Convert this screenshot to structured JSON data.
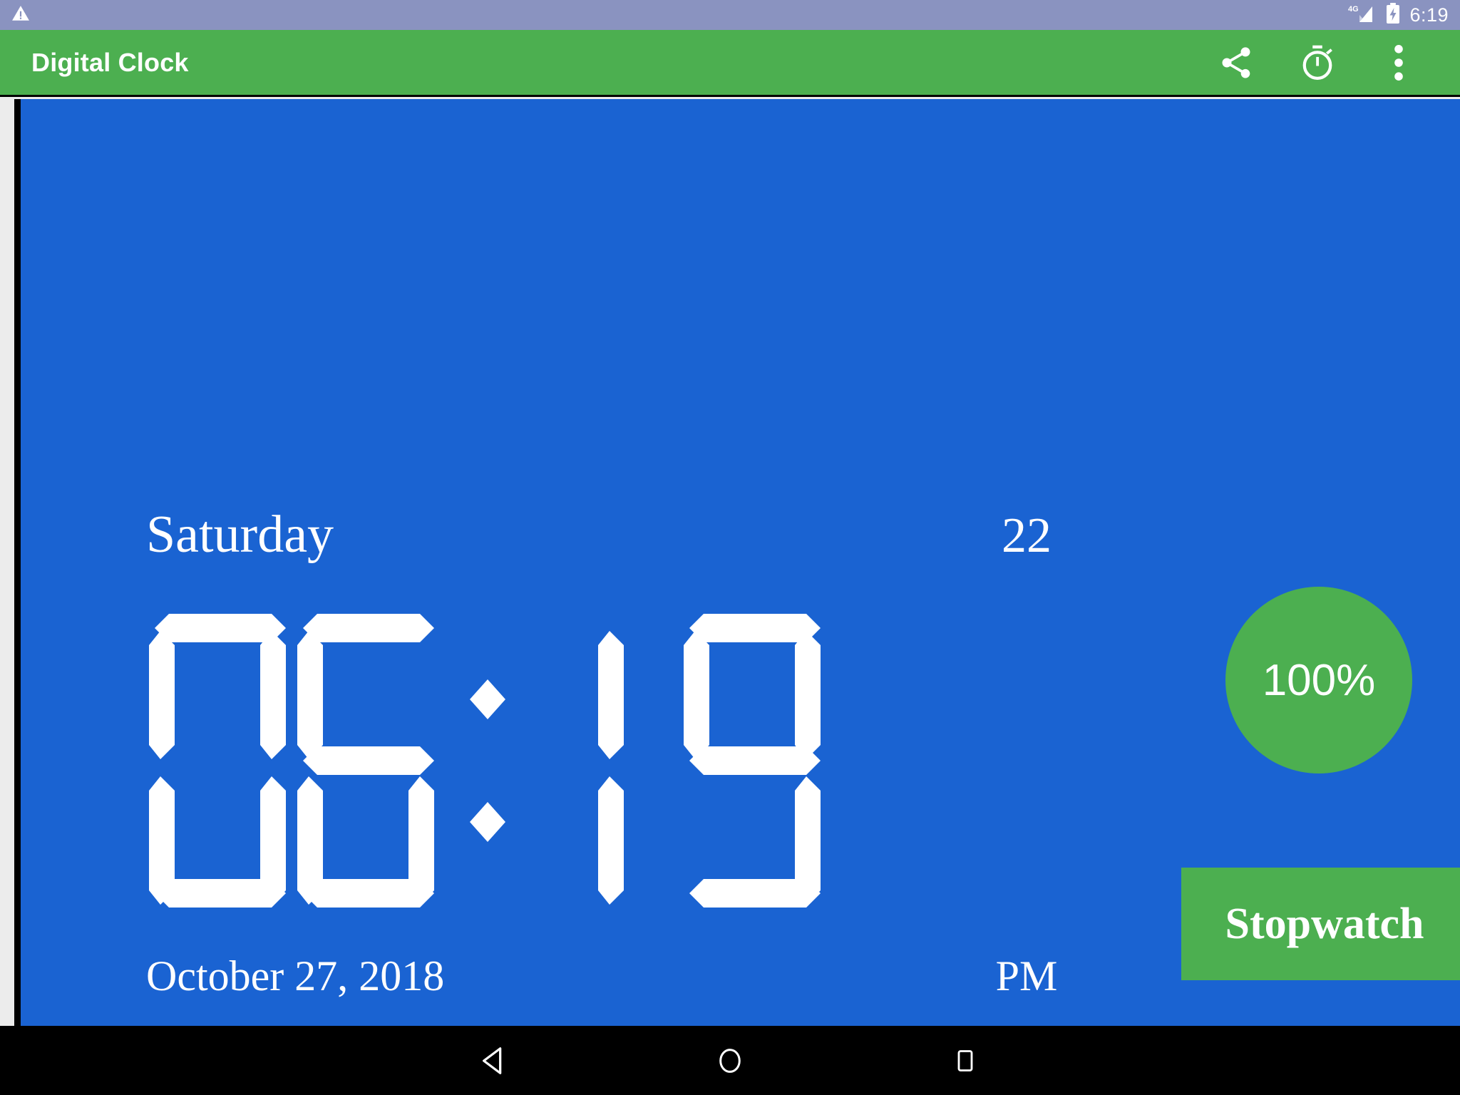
{
  "status_bar": {
    "warning_icon": "warning-triangle-icon",
    "network_label": "4G",
    "signal_icon": "signal-bars-icon",
    "battery_icon": "battery-charging-icon",
    "time": "6:19",
    "background_color": "#8a93c0"
  },
  "app_bar": {
    "title": "Digital Clock",
    "background_color": "#4caf50",
    "actions": [
      {
        "name": "share-icon",
        "label": "Share"
      },
      {
        "name": "stopwatch-icon",
        "label": "Stopwatch"
      },
      {
        "name": "overflow-menu-icon",
        "label": "More options"
      }
    ]
  },
  "clock": {
    "background_color": "#1a63d2",
    "day_of_week": "Saturday",
    "seconds": "22",
    "hours": "06",
    "minutes": "19",
    "hour_digits": [
      "0",
      "6"
    ],
    "minute_digits": [
      "1",
      "9"
    ],
    "separator": ":",
    "date": "October 27, 2018",
    "meridiem": "PM"
  },
  "battery": {
    "percent_label": "100%",
    "percent_value": 100,
    "color": "#4caf50"
  },
  "stopwatch_button": {
    "label": "Stopwatch",
    "color": "#4caf50"
  },
  "nav_bar": {
    "background_color": "#000000",
    "buttons": [
      {
        "name": "back-button",
        "label": "Back"
      },
      {
        "name": "home-button",
        "label": "Home"
      },
      {
        "name": "recents-button",
        "label": "Recent apps"
      }
    ]
  }
}
